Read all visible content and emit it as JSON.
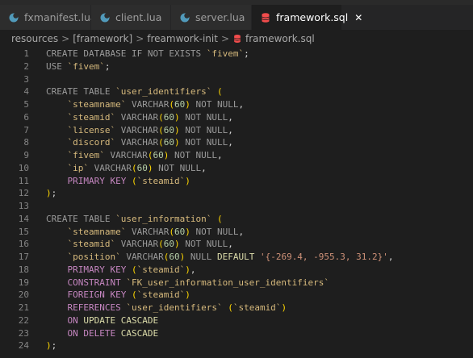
{
  "tabs": [
    {
      "label": "fxmanifest.lua",
      "icon": "moon-icon",
      "active": false
    },
    {
      "label": "client.lua",
      "icon": "moon-icon",
      "active": false
    },
    {
      "label": "server.lua",
      "icon": "moon-icon",
      "active": false
    },
    {
      "label": "framework.sql",
      "icon": "database-icon",
      "active": true,
      "close": "✕"
    }
  ],
  "breadcrumb": {
    "items": [
      "resources",
      "[framework]",
      "freamwork-init",
      "framework.sql"
    ],
    "separator": ">"
  },
  "code_lines": [
    {
      "n": "1",
      "t": "CREATE DATABASE IF NOT EXISTS `fivem`;"
    },
    {
      "n": "2",
      "t": "USE `fivem`;"
    },
    {
      "n": "3",
      "t": ""
    },
    {
      "n": "4",
      "t": "CREATE TABLE `user_identifiers` ("
    },
    {
      "n": "5",
      "t": "    `steamname` VARCHAR(60) NOT NULL,"
    },
    {
      "n": "6",
      "t": "    `steamid` VARCHAR(60) NOT NULL,"
    },
    {
      "n": "7",
      "t": "    `license` VARCHAR(60) NOT NULL,"
    },
    {
      "n": "8",
      "t": "    `discord` VARCHAR(60) NOT NULL,"
    },
    {
      "n": "9",
      "t": "    `fivem` VARCHAR(60) NOT NULL,"
    },
    {
      "n": "10",
      "t": "    `ip` VARCHAR(60) NOT NULL,"
    },
    {
      "n": "11",
      "t": "    PRIMARY KEY (`steamid`)"
    },
    {
      "n": "12",
      "t": ");"
    },
    {
      "n": "13",
      "t": ""
    },
    {
      "n": "14",
      "t": "CREATE TABLE `user_information` ("
    },
    {
      "n": "15",
      "t": "    `steamname` VARCHAR(60) NOT NULL,"
    },
    {
      "n": "16",
      "t": "    `steamid` VARCHAR(60) NOT NULL,"
    },
    {
      "n": "17",
      "t": "    `position` VARCHAR(60) NULL DEFAULT '{-269.4, -955.3, 31.2}',"
    },
    {
      "n": "18",
      "t": "    PRIMARY KEY (`steamid`),"
    },
    {
      "n": "19",
      "t": "    CONSTRAINT `FK_user_information_user_identifiers`"
    },
    {
      "n": "20",
      "t": "    FOREIGN KEY (`steamid`)"
    },
    {
      "n": "21",
      "t": "    REFERENCES `user_identifiers` (`steamid`)"
    },
    {
      "n": "22",
      "t": "    ON UPDATE CASCADE"
    },
    {
      "n": "23",
      "t": "    ON DELETE CASCADE"
    },
    {
      "n": "24",
      "t": ");"
    }
  ],
  "colors": {
    "background": "#1e1e1e",
    "tab_bar": "#252526",
    "active_tab_icon": "#f14c4c",
    "lua_icon": "#519aba",
    "keyword": "#9a9a9a",
    "identifier": "#d7ba7d",
    "string": "#ce9178",
    "number": "#b5cea8",
    "purple_keyword": "#c586c0"
  }
}
